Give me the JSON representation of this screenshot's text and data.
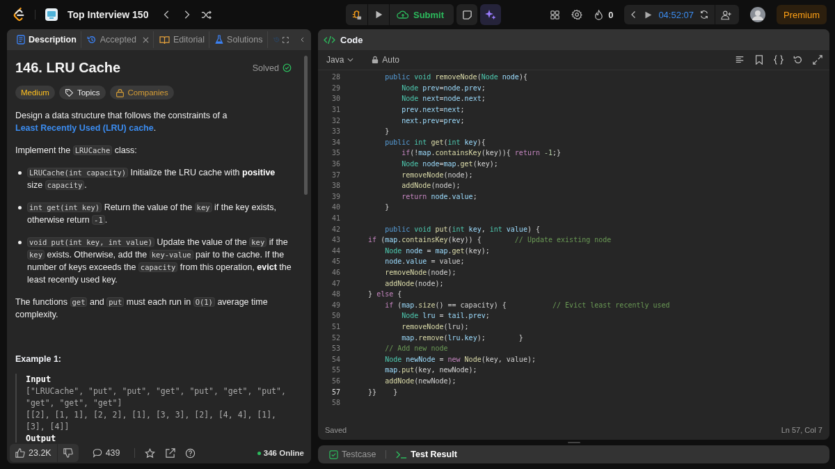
{
  "topbar": {
    "title": "Top Interview 150",
    "submit": "Submit",
    "streak": "0",
    "timer": "04:52:07",
    "premium": "Premium"
  },
  "description_panel": {
    "tabs": [
      {
        "kind": "description",
        "label": "Description",
        "selected": true,
        "closable": false
      },
      {
        "kind": "submission",
        "label": "Accepted",
        "selected": false,
        "closable": true
      },
      {
        "kind": "editorial",
        "label": "Editorial",
        "selected": false,
        "closable": false
      },
      {
        "kind": "solutions",
        "label": "Solutions",
        "selected": false,
        "closable": false
      }
    ],
    "title": "146. LRU Cache",
    "status": "Solved",
    "tags": [
      {
        "kind": "difficulty",
        "label": "Medium"
      },
      {
        "kind": "topics",
        "label": "Topics"
      },
      {
        "kind": "companies",
        "label": "Companies"
      }
    ],
    "intro": [
      [
        {
          "kind": "text",
          "text": "Design a data structure that follows the constraints of a "
        },
        {
          "kind": "link",
          "text": "Least Recently Used (LRU) cache"
        },
        {
          "kind": "text",
          "text": "."
        }
      ],
      [
        {
          "kind": "text",
          "text": "Implement the "
        },
        {
          "kind": "code",
          "text": "LRUCache"
        },
        {
          "kind": "text",
          "text": " class:"
        }
      ]
    ],
    "bullets": [
      [
        {
          "kind": "code",
          "text": "LRUCache(int capacity)"
        },
        {
          "kind": "text",
          "text": " Initialize the LRU cache with "
        },
        {
          "kind": "bold",
          "text": "positive"
        },
        {
          "kind": "text",
          "text": " size "
        },
        {
          "kind": "code",
          "text": "capacity"
        },
        {
          "kind": "text",
          "text": "."
        }
      ],
      [
        {
          "kind": "code",
          "text": "int get(int key)"
        },
        {
          "kind": "text",
          "text": " Return the value of the "
        },
        {
          "kind": "code",
          "text": "key"
        },
        {
          "kind": "text",
          "text": " if the key exists, otherwise return "
        },
        {
          "kind": "code",
          "text": "-1"
        },
        {
          "kind": "text",
          "text": "."
        }
      ],
      [
        {
          "kind": "code",
          "text": "void put(int key, int value)"
        },
        {
          "kind": "text",
          "text": " Update the value of the "
        },
        {
          "kind": "code",
          "text": "key"
        },
        {
          "kind": "text",
          "text": " if the "
        },
        {
          "kind": "code",
          "text": "key"
        },
        {
          "kind": "text",
          "text": " exists. Otherwise, add the "
        },
        {
          "kind": "code",
          "text": "key-value"
        },
        {
          "kind": "text",
          "text": " pair to the cache. If the number of keys exceeds the "
        },
        {
          "kind": "code",
          "text": "capacity"
        },
        {
          "kind": "text",
          "text": " from this operation, "
        },
        {
          "kind": "bold",
          "text": "evict"
        },
        {
          "kind": "text",
          "text": " the least recently used key."
        }
      ]
    ],
    "note": [
      {
        "kind": "text",
        "text": "The functions "
      },
      {
        "kind": "code",
        "text": "get"
      },
      {
        "kind": "text",
        "text": " and "
      },
      {
        "kind": "code",
        "text": "put"
      },
      {
        "kind": "text",
        "text": " must each run in "
      },
      {
        "kind": "code",
        "text": "O(1)"
      },
      {
        "kind": "text",
        "text": " average time complexity."
      }
    ],
    "example": {
      "heading": "Example 1:",
      "input_label": "Input",
      "input_lines": [
        "[\"LRUCache\", \"put\", \"put\", \"get\", \"put\", \"get\", \"put\", \"get\", \"get\", \"get\"]",
        "[[2], [1, 1], [2, 2], [1], [3, 3], [2], [4, 4], [1], [3], [4]]"
      ],
      "output_label": "Output"
    },
    "footer": {
      "likes": "23.2K",
      "comments": "439",
      "online": "346 Online"
    }
  },
  "code_panel": {
    "title": "Code",
    "language": "Java",
    "mode": "Auto",
    "lines": [
      {
        "number": "28",
        "current": false,
        "tokens": [
          {
            "kind": "kw",
            "text": "        public "
          },
          {
            "kind": "ty",
            "text": "void "
          },
          {
            "kind": "fn",
            "text": "removeNode"
          },
          {
            "kind": "p",
            "text": "("
          },
          {
            "kind": "ty",
            "text": "Node "
          },
          {
            "kind": "var",
            "text": "node"
          },
          {
            "kind": "p",
            "text": "){"
          }
        ]
      },
      {
        "number": "29",
        "current": false,
        "tokens": [
          {
            "kind": "ty",
            "text": "            Node "
          },
          {
            "kind": "var",
            "text": "prev"
          },
          {
            "kind": "p",
            "text": "="
          },
          {
            "kind": "var",
            "text": "node"
          },
          {
            "kind": "p",
            "text": "."
          },
          {
            "kind": "var",
            "text": "prev"
          },
          {
            "kind": "p",
            "text": ";"
          }
        ]
      },
      {
        "number": "30",
        "current": false,
        "tokens": [
          {
            "kind": "ty",
            "text": "            Node "
          },
          {
            "kind": "var",
            "text": "next"
          },
          {
            "kind": "p",
            "text": "="
          },
          {
            "kind": "var",
            "text": "node"
          },
          {
            "kind": "p",
            "text": "."
          },
          {
            "kind": "var",
            "text": "next"
          },
          {
            "kind": "p",
            "text": ";"
          }
        ]
      },
      {
        "number": "31",
        "current": false,
        "tokens": [
          {
            "kind": "var",
            "text": "            prev"
          },
          {
            "kind": "p",
            "text": "."
          },
          {
            "kind": "var",
            "text": "next"
          },
          {
            "kind": "p",
            "text": "="
          },
          {
            "kind": "var",
            "text": "next"
          },
          {
            "kind": "p",
            "text": ";"
          }
        ]
      },
      {
        "number": "32",
        "current": false,
        "tokens": [
          {
            "kind": "var",
            "text": "            next"
          },
          {
            "kind": "p",
            "text": "."
          },
          {
            "kind": "var",
            "text": "prev"
          },
          {
            "kind": "p",
            "text": "="
          },
          {
            "kind": "var",
            "text": "prev"
          },
          {
            "kind": "p",
            "text": ";"
          }
        ]
      },
      {
        "number": "33",
        "current": false,
        "tokens": [
          {
            "kind": "p",
            "text": "        }"
          }
        ]
      },
      {
        "number": "34",
        "current": false,
        "tokens": [
          {
            "kind": "kw",
            "text": "        public "
          },
          {
            "kind": "ty",
            "text": "int "
          },
          {
            "kind": "fn",
            "text": "get"
          },
          {
            "kind": "p",
            "text": "("
          },
          {
            "kind": "ty",
            "text": "int "
          },
          {
            "kind": "var",
            "text": "key"
          },
          {
            "kind": "p",
            "text": "){"
          }
        ]
      },
      {
        "number": "35",
        "current": false,
        "tokens": [
          {
            "kind": "ctl",
            "text": "            if"
          },
          {
            "kind": "p",
            "text": "(!"
          },
          {
            "kind": "var",
            "text": "map"
          },
          {
            "kind": "p",
            "text": "."
          },
          {
            "kind": "fn",
            "text": "containsKey"
          },
          {
            "kind": "p",
            "text": "(key)){ "
          },
          {
            "kind": "ctl",
            "text": "return "
          },
          {
            "kind": "num",
            "text": "-1"
          },
          {
            "kind": "p",
            "text": ";}"
          }
        ]
      },
      {
        "number": "36",
        "current": false,
        "tokens": [
          {
            "kind": "ty",
            "text": "            Node "
          },
          {
            "kind": "var",
            "text": "node"
          },
          {
            "kind": "p",
            "text": "="
          },
          {
            "kind": "var",
            "text": "map"
          },
          {
            "kind": "p",
            "text": "."
          },
          {
            "kind": "fn",
            "text": "get"
          },
          {
            "kind": "p",
            "text": "(key);"
          }
        ]
      },
      {
        "number": "37",
        "current": false,
        "tokens": [
          {
            "kind": "fn",
            "text": "            removeNode"
          },
          {
            "kind": "p",
            "text": "(node);"
          }
        ]
      },
      {
        "number": "38",
        "current": false,
        "tokens": [
          {
            "kind": "fn",
            "text": "            addNode"
          },
          {
            "kind": "p",
            "text": "(node);"
          }
        ]
      },
      {
        "number": "39",
        "current": false,
        "tokens": [
          {
            "kind": "ctl",
            "text": "            return "
          },
          {
            "kind": "var",
            "text": "node"
          },
          {
            "kind": "p",
            "text": "."
          },
          {
            "kind": "var",
            "text": "value"
          },
          {
            "kind": "p",
            "text": ";"
          }
        ]
      },
      {
        "number": "40",
        "current": false,
        "tokens": [
          {
            "kind": "p",
            "text": "        }"
          }
        ]
      },
      {
        "number": "41",
        "current": false
      },
      {
        "number": "42",
        "current": false,
        "tokens": [
          {
            "kind": "kw",
            "text": "        public "
          },
          {
            "kind": "ty",
            "text": "void "
          },
          {
            "kind": "fn",
            "text": "put"
          },
          {
            "kind": "p",
            "text": "("
          },
          {
            "kind": "ty",
            "text": "int "
          },
          {
            "kind": "var",
            "text": "key"
          },
          {
            "kind": "p",
            "text": ", "
          },
          {
            "kind": "ty",
            "text": "int "
          },
          {
            "kind": "var",
            "text": "value"
          },
          {
            "kind": "p",
            "text": ") {"
          }
        ]
      },
      {
        "number": "43",
        "current": false,
        "tokens": [
          {
            "kind": "ctl",
            "text": "    if "
          },
          {
            "kind": "p",
            "text": "("
          },
          {
            "kind": "var",
            "text": "map"
          },
          {
            "kind": "p",
            "text": "."
          },
          {
            "kind": "fn",
            "text": "containsKey"
          },
          {
            "kind": "p",
            "text": "(key)) {        "
          },
          {
            "kind": "cm",
            "text": "// Update existing node"
          }
        ]
      },
      {
        "number": "44",
        "current": false,
        "tokens": [
          {
            "kind": "ty",
            "text": "        Node "
          },
          {
            "kind": "var",
            "text": "node"
          },
          {
            "kind": "p",
            "text": " = "
          },
          {
            "kind": "var",
            "text": "map"
          },
          {
            "kind": "p",
            "text": "."
          },
          {
            "kind": "fn",
            "text": "get"
          },
          {
            "kind": "p",
            "text": "(key);"
          }
        ]
      },
      {
        "number": "45",
        "current": false,
        "tokens": [
          {
            "kind": "var",
            "text": "        node"
          },
          {
            "kind": "p",
            "text": "."
          },
          {
            "kind": "var",
            "text": "value"
          },
          {
            "kind": "p",
            "text": " = value;"
          }
        ]
      },
      {
        "number": "46",
        "current": false,
        "tokens": [
          {
            "kind": "fn",
            "text": "        removeNode"
          },
          {
            "kind": "p",
            "text": "(node);"
          }
        ]
      },
      {
        "number": "47",
        "current": false,
        "tokens": [
          {
            "kind": "fn",
            "text": "        addNode"
          },
          {
            "kind": "p",
            "text": "(node);"
          }
        ]
      },
      {
        "number": "48",
        "current": false,
        "tokens": [
          {
            "kind": "p",
            "text": "    } "
          },
          {
            "kind": "ctl",
            "text": "else"
          },
          {
            "kind": "p",
            "text": " {"
          }
        ]
      },
      {
        "number": "49",
        "current": false,
        "tokens": [
          {
            "kind": "ctl",
            "text": "        if "
          },
          {
            "kind": "p",
            "text": "("
          },
          {
            "kind": "var",
            "text": "map"
          },
          {
            "kind": "p",
            "text": "."
          },
          {
            "kind": "fn",
            "text": "size"
          },
          {
            "kind": "p",
            "text": "() == capacity) {           "
          },
          {
            "kind": "cm",
            "text": "// Evict least recently used"
          }
        ]
      },
      {
        "number": "50",
        "current": false,
        "tokens": [
          {
            "kind": "ty",
            "text": "            Node "
          },
          {
            "kind": "var",
            "text": "lru"
          },
          {
            "kind": "p",
            "text": " = "
          },
          {
            "kind": "var",
            "text": "tail"
          },
          {
            "kind": "p",
            "text": "."
          },
          {
            "kind": "var",
            "text": "prev"
          },
          {
            "kind": "p",
            "text": ";"
          }
        ]
      },
      {
        "number": "51",
        "current": false,
        "tokens": [
          {
            "kind": "fn",
            "text": "            removeNode"
          },
          {
            "kind": "p",
            "text": "(lru);"
          }
        ]
      },
      {
        "number": "52",
        "current": false,
        "tokens": [
          {
            "kind": "var",
            "text": "            map"
          },
          {
            "kind": "p",
            "text": "."
          },
          {
            "kind": "fn",
            "text": "remove"
          },
          {
            "kind": "p",
            "text": "("
          },
          {
            "kind": "var",
            "text": "lru"
          },
          {
            "kind": "p",
            "text": "."
          },
          {
            "kind": "var",
            "text": "key"
          },
          {
            "kind": "p",
            "text": ");        }"
          }
        ]
      },
      {
        "number": "53",
        "current": false,
        "tokens": [
          {
            "kind": "cm",
            "text": "        // Add new node"
          }
        ]
      },
      {
        "number": "54",
        "current": false,
        "tokens": [
          {
            "kind": "ty",
            "text": "        Node "
          },
          {
            "kind": "var",
            "text": "newNode"
          },
          {
            "kind": "p",
            "text": " = "
          },
          {
            "kind": "ctl",
            "text": "new "
          },
          {
            "kind": "fn",
            "text": "Node"
          },
          {
            "kind": "p",
            "text": "(key, value);"
          }
        ]
      },
      {
        "number": "55",
        "current": false,
        "tokens": [
          {
            "kind": "var",
            "text": "        map"
          },
          {
            "kind": "p",
            "text": "."
          },
          {
            "kind": "fn",
            "text": "put"
          },
          {
            "kind": "p",
            "text": "(key, newNode);"
          }
        ]
      },
      {
        "number": "56",
        "current": false,
        "tokens": [
          {
            "kind": "fn",
            "text": "        addNode"
          },
          {
            "kind": "p",
            "text": "(newNode);"
          }
        ]
      },
      {
        "number": "57",
        "current": true,
        "tokens": [
          {
            "kind": "p",
            "text": "    }}    }"
          }
        ]
      },
      {
        "number": "58",
        "current": false
      }
    ],
    "status": "Saved",
    "cursor": "Ln 57, Col 7"
  },
  "bottom_tabs": [
    {
      "kind": "testcase",
      "label": "Testcase",
      "selected": false
    },
    {
      "kind": "result",
      "label": "Test Result",
      "selected": true
    }
  ]
}
